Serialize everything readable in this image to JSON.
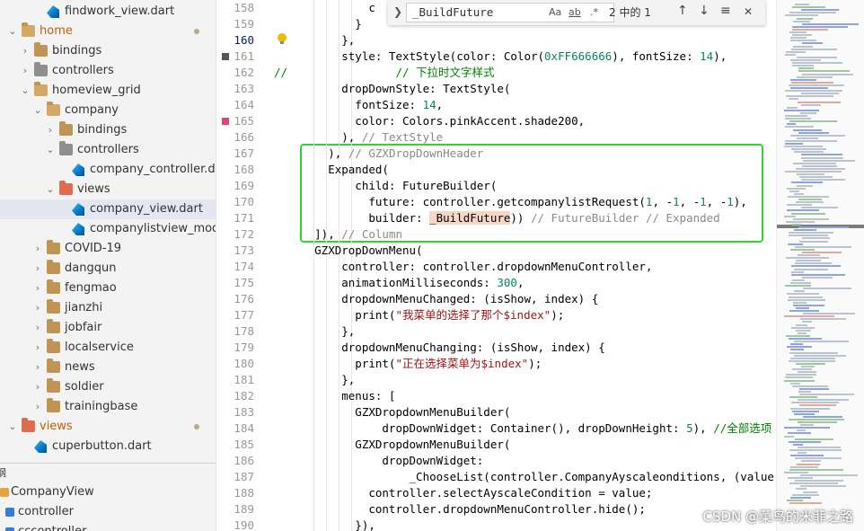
{
  "explorer": {
    "items": [
      {
        "label": "findwork_view.dart",
        "type": "dart",
        "indent": 2,
        "chevron": ""
      },
      {
        "label": "home",
        "type": "folder-open",
        "indent": 0,
        "chevron": "open",
        "modified": true,
        "color": "#c06000"
      },
      {
        "label": "bindings",
        "type": "folder",
        "indent": 1,
        "chevron": "closed"
      },
      {
        "label": "controllers",
        "type": "folder-special",
        "indent": 1,
        "chevron": "closed"
      },
      {
        "label": "homeview_grid",
        "type": "folder-open",
        "indent": 1,
        "chevron": "open"
      },
      {
        "label": "company",
        "type": "folder-open",
        "indent": 2,
        "chevron": "open"
      },
      {
        "label": "bindings",
        "type": "folder",
        "indent": 3,
        "chevron": "closed"
      },
      {
        "label": "controllers",
        "type": "folder-special",
        "indent": 3,
        "chevron": "open"
      },
      {
        "label": "company_controller.dart",
        "type": "dart",
        "indent": 4,
        "chevron": ""
      },
      {
        "label": "views",
        "type": "folder-red",
        "indent": 3,
        "chevron": "open"
      },
      {
        "label": "company_view.dart",
        "type": "dart",
        "indent": 4,
        "chevron": "",
        "selected": true
      },
      {
        "label": "companylistview_model.d...",
        "type": "dart",
        "indent": 4,
        "chevron": ""
      },
      {
        "label": "COVID-19",
        "type": "folder",
        "indent": 2,
        "chevron": "closed"
      },
      {
        "label": "dangqun",
        "type": "folder",
        "indent": 2,
        "chevron": "closed"
      },
      {
        "label": "fengmao",
        "type": "folder",
        "indent": 2,
        "chevron": "closed"
      },
      {
        "label": "jianzhi",
        "type": "folder",
        "indent": 2,
        "chevron": "closed"
      },
      {
        "label": "jobfair",
        "type": "folder",
        "indent": 2,
        "chevron": "closed"
      },
      {
        "label": "localservice",
        "type": "folder",
        "indent": 2,
        "chevron": "closed"
      },
      {
        "label": "news",
        "type": "folder",
        "indent": 2,
        "chevron": "closed"
      },
      {
        "label": "soldier",
        "type": "folder",
        "indent": 2,
        "chevron": "closed"
      },
      {
        "label": "trainingbase",
        "type": "folder",
        "indent": 2,
        "chevron": "closed"
      },
      {
        "label": "views",
        "type": "folder-red",
        "indent": 0,
        "chevron": "open",
        "modified": true,
        "color": "#c06000"
      },
      {
        "label": "cuperbutton.dart",
        "type": "dart",
        "indent": 1,
        "chevron": ""
      }
    ],
    "outline_title": "纲",
    "outline": [
      {
        "label": "CompanyView"
      },
      {
        "label": "controller"
      },
      {
        "label": "cccontroller"
      }
    ]
  },
  "find_widget": {
    "query": "_BuildFuture",
    "opt_case": "Aa",
    "opt_word": "ab",
    "opt_regex": ".*",
    "count": "2 中的 1",
    "prev": "↑",
    "next": "↓",
    "selection": "≡",
    "close": "✕"
  },
  "editor": {
    "active_line": "160",
    "lines": [
      {
        "n": "158",
        "html": "              <span>c</span>"
      },
      {
        "n": "159",
        "html": "            }"
      },
      {
        "n": "160",
        "html": "          },"
      },
      {
        "n": "161",
        "html": "          style: TextStyle(color: Color(<span class='num'>0xFF666666</span>), fontSize: <span class='num'>14</span>),"
      },
      {
        "n": "162",
        "html": "<span class='cm'>//                // 下拉时文字样式</span>"
      },
      {
        "n": "163",
        "html": "          dropDownStyle: TextStyle("
      },
      {
        "n": "164",
        "html": "            fontSize: <span class='num'>14</span>,"
      },
      {
        "n": "165",
        "html": "            color: Colors.pinkAccent.shade200,"
      },
      {
        "n": "166",
        "html": "          ), <span class='fold'>// TextStyle</span>"
      },
      {
        "n": "167",
        "html": "        ), <span class='fold'>// GZXDropDownHeader</span>"
      },
      {
        "n": "168",
        "html": "        Expanded("
      },
      {
        "n": "169",
        "html": "            child: FutureBuilder("
      },
      {
        "n": "170",
        "html": "              future: controller.getcompanylistRequest(<span class='num'>1</span>, -<span class='num'>1</span>, -<span class='num'>1</span>, -<span class='num'>1</span>),"
      },
      {
        "n": "171",
        "html": "              builder: <span class='hl'>_BuildFuture</span>)) <span class='fold'>// FutureBuilder // Expanded</span>"
      },
      {
        "n": "172",
        "html": "      ]), <span class='fold'>// Column</span>"
      },
      {
        "n": "173",
        "html": "      GZXDropDownMenu("
      },
      {
        "n": "174",
        "html": "          controller: controller.dropdownMenuController,"
      },
      {
        "n": "175",
        "html": "          animationMilliseconds: <span class='num'>300</span>,"
      },
      {
        "n": "176",
        "html": "          dropdownMenuChanged: (isShow, index) {"
      },
      {
        "n": "177",
        "html": "            print(<span class='str'>\"我菜单的选择了那个$index\"</span>);"
      },
      {
        "n": "178",
        "html": "          },"
      },
      {
        "n": "179",
        "html": "          dropdownMenuChanging: (isShow, index) {"
      },
      {
        "n": "180",
        "html": "            print(<span class='str'>\"正在选择菜单为$index\"</span>);"
      },
      {
        "n": "181",
        "html": "          },"
      },
      {
        "n": "182",
        "html": "          menus: ["
      },
      {
        "n": "183",
        "html": "            GZXDropdownMenuBuilder("
      },
      {
        "n": "184",
        "html": "                dropDownWidget: Container(), dropDownHeight: <span class='num'>5</span>), <span class='cm'>//全部选项</span>"
      },
      {
        "n": "185",
        "html": "            GZXDropdownMenuBuilder("
      },
      {
        "n": "186",
        "html": "                dropDownWidget:"
      },
      {
        "n": "187",
        "html": "                    _ChooseList(controller.CompanyAyscaleonditions, (value) {"
      },
      {
        "n": "188",
        "html": "              controller.selectAyscaleCondition = value;"
      },
      {
        "n": "189",
        "html": "              controller.dropdownMenuController.hide();"
      },
      {
        "n": "190",
        "html": "            }),"
      }
    ]
  },
  "watermark": "CSDN @菜鸟的米菲之路"
}
